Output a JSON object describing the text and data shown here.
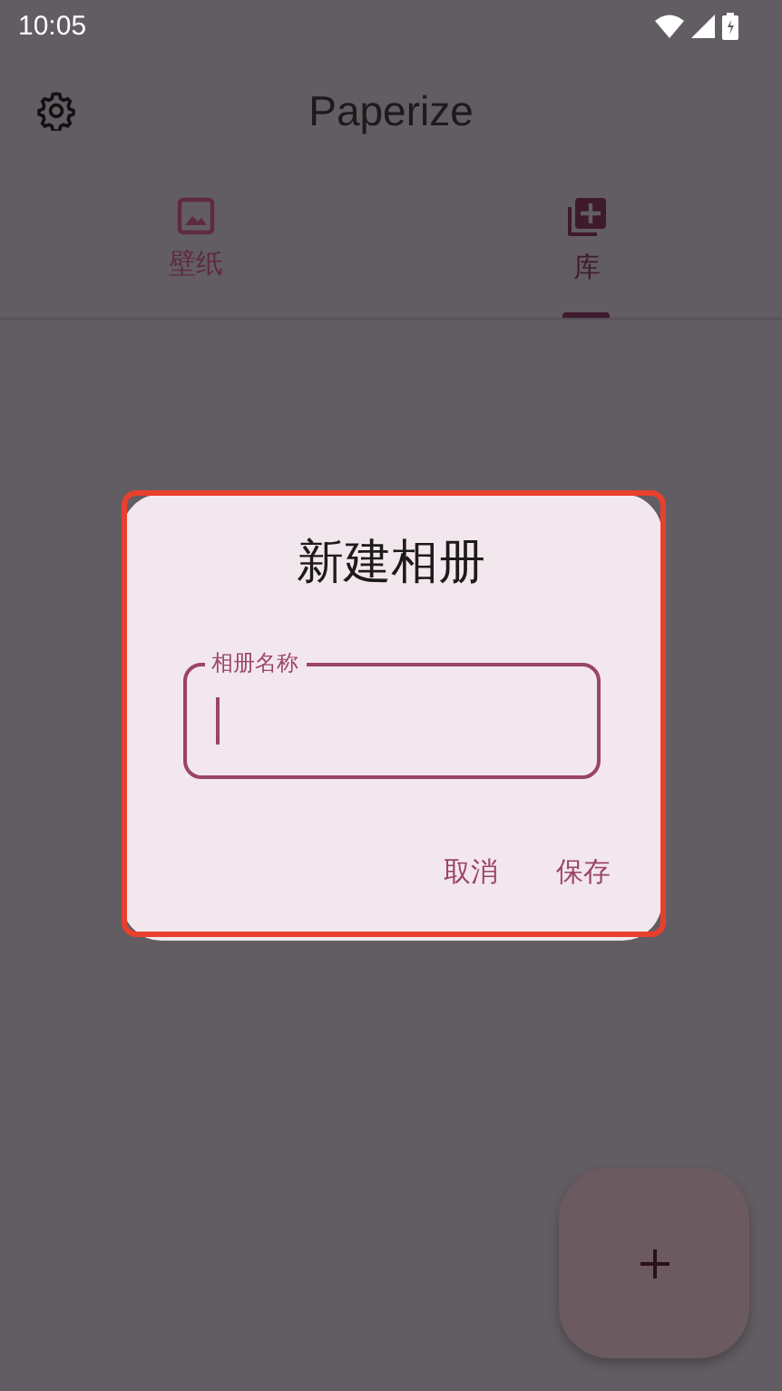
{
  "status_bar": {
    "time": "10:05"
  },
  "app_bar": {
    "title": "Paperize"
  },
  "tabs": [
    {
      "label": "壁纸",
      "kind": "image",
      "selected": false
    },
    {
      "label": "库",
      "kind": "library",
      "selected": true
    }
  ],
  "dialog": {
    "title": "新建相册",
    "field": {
      "label": "相册名称",
      "focused": true
    },
    "buttons": [
      "取消",
      "保存"
    ],
    "highlighted": true
  }
}
